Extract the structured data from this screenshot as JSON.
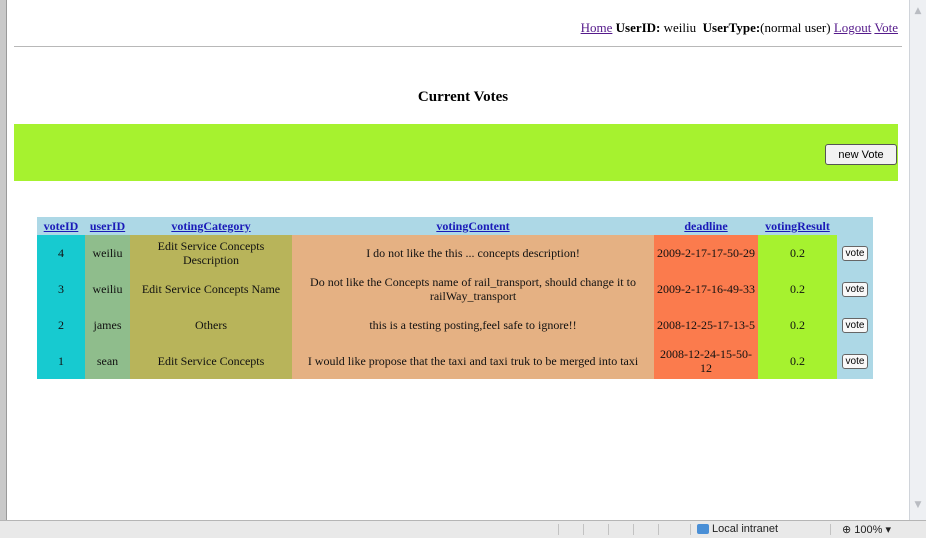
{
  "nav": {
    "home": "Home",
    "userid_label": "UserID:",
    "userid_value": "weiliu",
    "usertype_label": "UserType:",
    "usertype_value": "(normal user)",
    "logout": "Logout",
    "vote": "Vote"
  },
  "page_title": "Current Votes",
  "new_vote_button": "new Vote",
  "table": {
    "headers": [
      "voteID",
      "userID",
      "votingCategory",
      "votingContent",
      "deadline",
      "votingResult"
    ],
    "rows": [
      {
        "voteID": "4",
        "userID": "weiliu",
        "votingCategory": "Edit Service Concepts Description",
        "votingContent": "I do not like the this ... concepts description!",
        "deadline": "2009-2-17-17-50-29",
        "votingResult": "0.2",
        "button": "vote"
      },
      {
        "voteID": "3",
        "userID": "weiliu",
        "votingCategory": "Edit Service Concepts Name",
        "votingContent": "Do not like the Concepts name of rail_transport, should change it to railWay_transport",
        "deadline": "2009-2-17-16-49-33",
        "votingResult": "0.2",
        "button": "vote"
      },
      {
        "voteID": "2",
        "userID": "james",
        "votingCategory": "Others",
        "votingContent": "this is a testing posting,feel safe to ignore!!",
        "deadline": "2008-12-25-17-13-5",
        "votingResult": "0.2",
        "button": "vote"
      },
      {
        "voteID": "1",
        "userID": "sean",
        "votingCategory": "Edit Service Concepts",
        "votingContent": "I would like propose that the taxi and taxi truk to be merged into taxi",
        "deadline": "2008-12-24-15-50-12",
        "votingResult": "0.2",
        "button": "vote"
      }
    ]
  },
  "statusbar": {
    "zone": "Local intranet",
    "zoom": "100%"
  },
  "colors": {
    "banner": "#a6f22f",
    "header_bg": "#add8e6",
    "id_col": "#17cad0",
    "user_col": "#8fbd8c",
    "category_col": "#b8b45a",
    "content_col": "#e5b183",
    "deadline_col": "#fb7b4d",
    "result_col": "#a6f22f"
  }
}
